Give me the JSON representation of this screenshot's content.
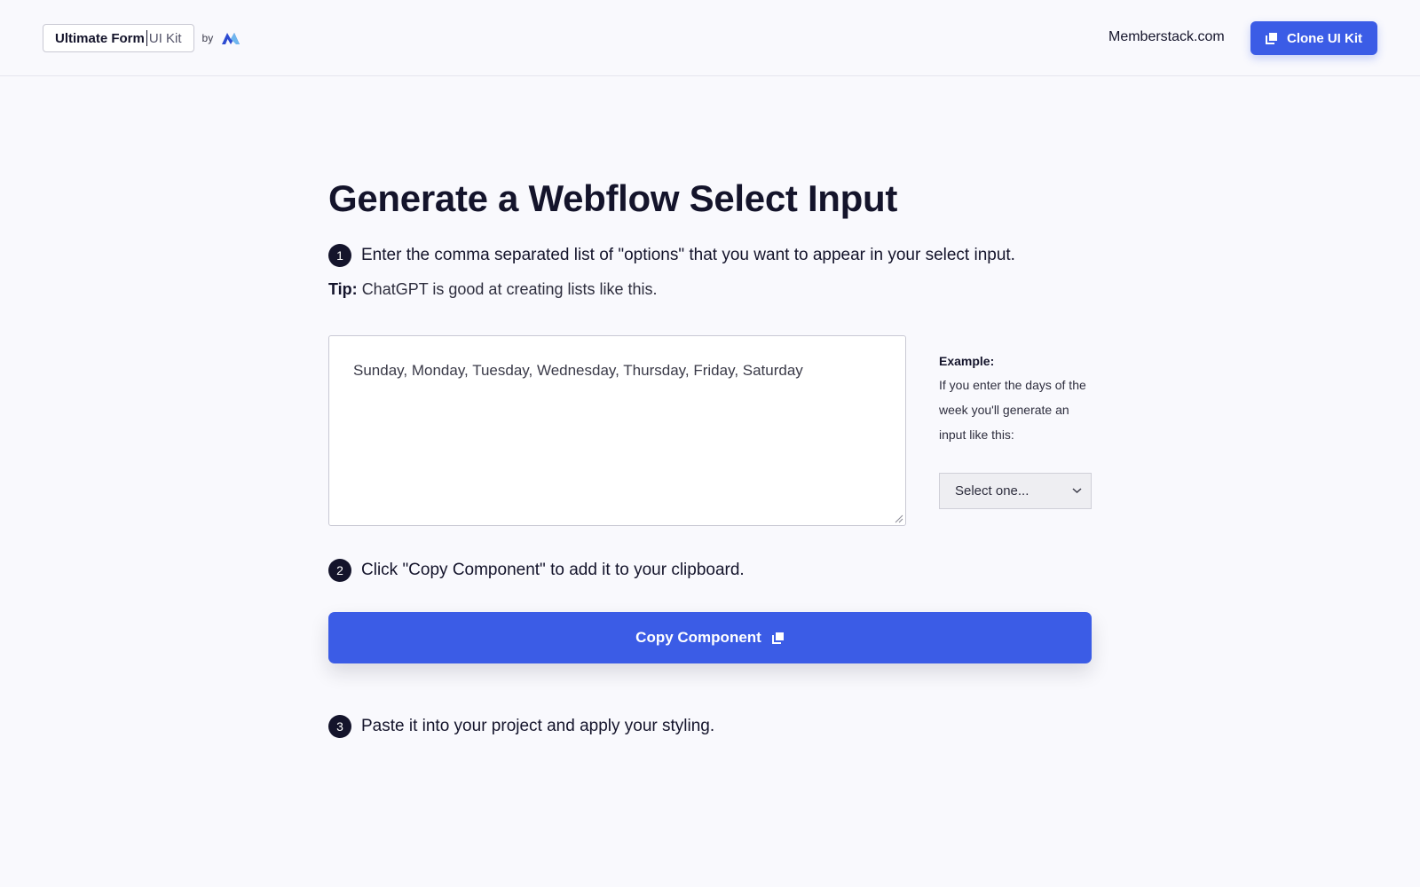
{
  "header": {
    "brand_bold": "Ultimate Form",
    "brand_light": "UI Kit",
    "brand_by": "by",
    "nav_link": "Memberstack.com",
    "clone_button": "Clone UI Kit"
  },
  "main": {
    "title": "Generate a Webflow Select Input",
    "steps": [
      {
        "number": "1",
        "text": "Enter the comma separated list of \"options\" that you want to appear in your select input."
      },
      {
        "number": "2",
        "text": "Click \"Copy Component\" to add it to your clipboard."
      },
      {
        "number": "3",
        "text": "Paste it into your project and apply your styling."
      }
    ],
    "tip_label": "Tip:",
    "tip_text": "ChatGPT is good at creating lists like this.",
    "options_input_value": "Sunday, Monday, Tuesday, Wednesday, Thursday, Friday, Saturday",
    "example": {
      "title": "Example:",
      "text": "If you enter the days of the week you'll generate an input like this:",
      "select_value": "Select one..."
    },
    "copy_button": "Copy Component"
  },
  "colors": {
    "accent": "#3b5ce6",
    "text_dark": "#14142b",
    "background": "#f9f9fd"
  },
  "icons": {
    "logo": "memberstack-logo-icon",
    "clone": "copy-icon",
    "copy": "copy-icon",
    "select": "chevron-down-icon"
  }
}
